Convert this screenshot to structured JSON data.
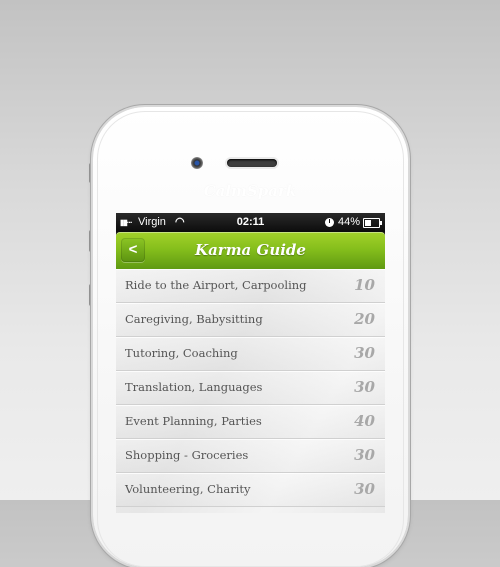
{
  "device": {
    "brand": "CalmSpark"
  },
  "status_bar": {
    "signal": "▮▮···",
    "carrier": "Virgin",
    "wifi_icon": "◠",
    "time": "02:11",
    "battery_percent": "44%"
  },
  "navbar": {
    "back_label": "<",
    "title": "Karma Guide"
  },
  "list": {
    "items": [
      {
        "label": "Ride to the Airport, Carpooling",
        "points": "10"
      },
      {
        "label": "Caregiving, Babysitting",
        "points": "20"
      },
      {
        "label": "Tutoring, Coaching",
        "points": "30"
      },
      {
        "label": "Translation, Languages",
        "points": "30"
      },
      {
        "label": "Event Planning, Parties",
        "points": "40"
      },
      {
        "label": "Shopping - Groceries",
        "points": "30"
      },
      {
        "label": "Volunteering, Charity",
        "points": "30"
      }
    ]
  },
  "colors": {
    "accent": "#86bf1c",
    "points_text": "#a8a8a8",
    "label_text": "#555555"
  }
}
